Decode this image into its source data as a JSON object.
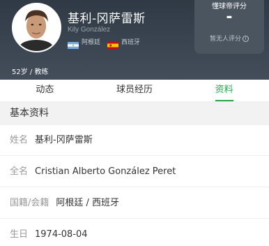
{
  "player": {
    "name": "基利-冈萨雷斯",
    "latin_name": "Kily González",
    "countries": [
      {
        "label": "阿根廷",
        "flag_icon": "argentina-flag-icon"
      },
      {
        "label": "西班牙",
        "flag_icon": "spain-flag-icon"
      }
    ],
    "age_role": "52岁 / 教练"
  },
  "rating": {
    "title": "懂球帝评分",
    "value": "-",
    "note": "暂无人评分",
    "info_icon": "ⓘ"
  },
  "tabs": [
    {
      "label": "动态",
      "active": false
    },
    {
      "label": "球员经历",
      "active": false
    },
    {
      "label": "资料",
      "active": true
    }
  ],
  "section": {
    "title": "基本资料"
  },
  "details": [
    {
      "label": "姓名",
      "value": "基利-冈萨雷斯"
    },
    {
      "label": "全名",
      "value": "Cristian Alberto González Peret"
    },
    {
      "label": "国籍/会籍",
      "value": "阿根廷 / 西班牙"
    },
    {
      "label": "生日",
      "value": "1974-08-04"
    }
  ],
  "colors": {
    "header_bg": "#3b4652",
    "accent": "#22a84a"
  }
}
